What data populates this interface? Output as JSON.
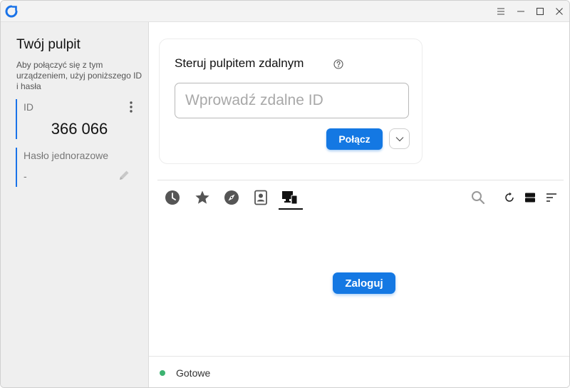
{
  "titlebar": {
    "accent": "#1a73e8"
  },
  "sidebar": {
    "title": "Twój pulpit",
    "description": "Aby połączyć się z tym urządzeniem, użyj poniższego ID i hasła",
    "id_label": "ID",
    "id_value": "366 066",
    "password_label": "Hasło jednorazowe",
    "password_value": "-"
  },
  "connect_card": {
    "title": "Steruj pulpitem zdalnym",
    "input_placeholder": "Wprowadź zdalne ID",
    "input_value": "",
    "connect_label": "Połącz"
  },
  "tabs": [
    {
      "icon": "clock-icon",
      "name": "recent"
    },
    {
      "icon": "star-icon",
      "name": "favorites"
    },
    {
      "icon": "compass-icon",
      "name": "discovered"
    },
    {
      "icon": "address-book-icon",
      "name": "address-book"
    },
    {
      "icon": "devices-icon",
      "name": "accessible-devices",
      "active": true
    }
  ],
  "tools": [
    "search-icon",
    "refresh-icon",
    "view-toggle-icon",
    "sort-icon"
  ],
  "login_label": "Zaloguj",
  "status": {
    "text": "Gotowe",
    "dot_color": "#3cb371"
  },
  "colors": {
    "primary": "#1478e3",
    "sidebar_accent": "#1a73e8"
  }
}
